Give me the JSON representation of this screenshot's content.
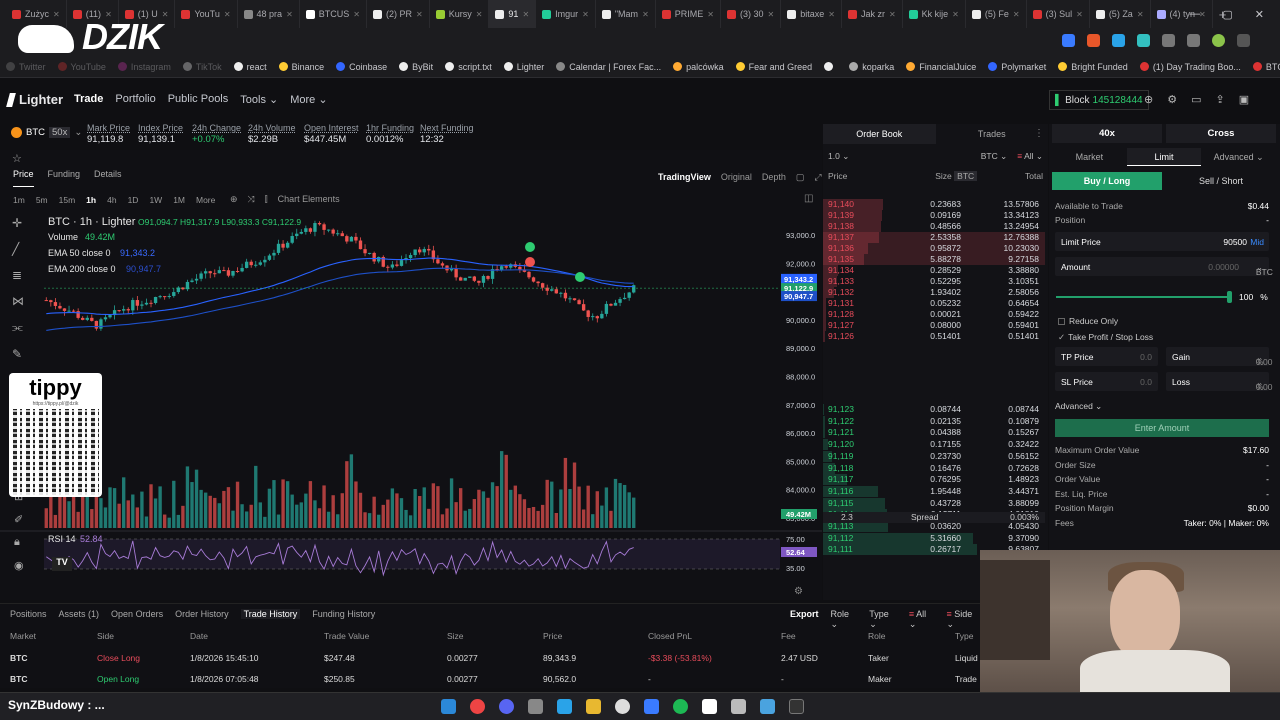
{
  "browser": {
    "tabs": [
      {
        "label": "Zużyc",
        "color": "#d33"
      },
      {
        "label": "(11)",
        "color": "#d33"
      },
      {
        "label": "(1) U",
        "color": "#d33"
      },
      {
        "label": "YouTu",
        "color": "#d33"
      },
      {
        "label": "48 pra",
        "color": "#888"
      },
      {
        "label": "BTCUS",
        "color": "#fff"
      },
      {
        "label": "(2) PR",
        "color": "#eee"
      },
      {
        "label": "Kursy",
        "color": "#9c3"
      },
      {
        "label": "91",
        "color": "#eee",
        "active": true
      },
      {
        "label": "Imgur",
        "color": "#2c9"
      },
      {
        "label": "\"Mam",
        "color": "#eee"
      },
      {
        "label": "PRIME",
        "color": "#d33"
      },
      {
        "label": "(3) 30",
        "color": "#d33"
      },
      {
        "label": "bitaxe",
        "color": "#eee"
      },
      {
        "label": "Jak zr",
        "color": "#d33"
      },
      {
        "label": "Kk kije",
        "color": "#2c9"
      },
      {
        "label": "(5) Fe",
        "color": "#eee"
      },
      {
        "label": "(3) Sul",
        "color": "#d33"
      },
      {
        "label": "(5) Za",
        "color": "#eee"
      },
      {
        "label": "(4) tyn",
        "color": "#aaf"
      }
    ],
    "new_tab": "+",
    "logo_text": "DZIK",
    "bookmarks": [
      {
        "label": "Twitter",
        "color": "#888"
      },
      {
        "label": "YouTube",
        "color": "#d33"
      },
      {
        "label": "Instagram",
        "color": "#c3a"
      },
      {
        "label": "TikTok",
        "color": "#eee"
      },
      {
        "label": "react",
        "color": "#eee"
      },
      {
        "label": "Binance",
        "color": "#fc3"
      },
      {
        "label": "Coinbase",
        "color": "#36f"
      },
      {
        "label": "ByBit",
        "color": "#eee"
      },
      {
        "label": "script.txt",
        "color": "#eee"
      },
      {
        "label": "Lighter",
        "color": "#eee"
      },
      {
        "label": "Calendar | Forex Fac...",
        "color": "#888"
      },
      {
        "label": "palcówka",
        "color": "#fa3"
      },
      {
        "label": "Fear and Greed",
        "color": "#fc3"
      },
      {
        "label": "",
        "color": "#eee"
      },
      {
        "label": "koparka",
        "color": "#aaa"
      },
      {
        "label": "FinancialJuice",
        "color": "#fa3"
      },
      {
        "label": "Polymarket",
        "color": "#36f"
      },
      {
        "label": "Bright Funded",
        "color": "#fc3"
      },
      {
        "label": "(1) Day Trading Boo...",
        "color": "#d33"
      },
      {
        "label": "BTC Elliot wave",
        "color": "#d33"
      }
    ]
  },
  "app": {
    "brand": "Lighter",
    "nav": [
      "Trade",
      "Portfolio",
      "Public Pools",
      "Tools",
      "More"
    ],
    "block_label": "Block",
    "block_number": "145128444"
  },
  "ticker": {
    "symbol": "BTC",
    "leverage": "50x",
    "stats": [
      {
        "label": "Mark Price",
        "value": "91,119.8",
        "tone": "normal"
      },
      {
        "label": "Index Price",
        "value": "91,139.1",
        "tone": "normal"
      },
      {
        "label": "24h Change",
        "value": "+0.07%",
        "tone": "green"
      },
      {
        "label": "24h Volume",
        "value": "$2.29B",
        "tone": "normal"
      },
      {
        "label": "Open Interest",
        "value": "$447.45M",
        "tone": "normal"
      },
      {
        "label": "1hr Funding",
        "value": "0.0012%",
        "tone": "normal"
      },
      {
        "label": "Next Funding",
        "value": "12:32",
        "tone": "normal"
      }
    ]
  },
  "chart": {
    "tabs": [
      "Price",
      "Funding",
      "Details"
    ],
    "views": [
      "TradingView",
      "Original",
      "Depth"
    ],
    "timeframes": [
      "1m",
      "5m",
      "15m",
      "1h",
      "4h",
      "1D",
      "1W",
      "1M",
      "More"
    ],
    "elements_label": "Chart Elements",
    "legend": {
      "title": "BTC · 1h · Lighter",
      "ohlc": "O91,094.7 H91,317.9 L90,933.3 C91,122.9",
      "volume_label": "Volume",
      "volume_value": "49.42M",
      "ema50_label": "EMA 50 close 0",
      "ema50_value": "91,343.2",
      "ema200_label": "EMA 200 close 0",
      "ema200_value": "90,947.7"
    },
    "price_axis": [
      "93,000.0",
      "92,000.0",
      "91,000.0",
      "90,000.0",
      "89,000.0",
      "88,000.0",
      "87,000.0",
      "86,000.0",
      "85,000.0",
      "84,000.0",
      "83,000.0"
    ],
    "price_tags": [
      "91,343.2",
      "91,122.9",
      "90,947.7"
    ],
    "volume_tag": "49.42M",
    "rsi": {
      "label": "RSI 14",
      "value": "52.84",
      "levels": [
        "75.00",
        "35.00"
      ],
      "tag": "52.64"
    },
    "tippy": {
      "title": "tippy",
      "url": "https://tippy.pl/@dzik"
    },
    "colors": {
      "up": "#26a69a",
      "down": "#ef5350",
      "ema50": "#2962ff",
      "ema200": "#1e50c8"
    }
  },
  "orderbook": {
    "tabs": [
      "Order Book",
      "Trades"
    ],
    "tick_size": "1.0",
    "unit": "BTC",
    "filter": "All",
    "headers": {
      "price": "Price",
      "size": "Size",
      "size_unit": "BTC",
      "total": "Total"
    },
    "asks": [
      [
        "91,140",
        "0.23683",
        "13.57806"
      ],
      [
        "91,139",
        "0.09169",
        "13.34123"
      ],
      [
        "91,138",
        "0.48566",
        "13.24954"
      ],
      [
        "91,137",
        "2.53358",
        "12.76388"
      ],
      [
        "91,136",
        "0.95872",
        "10.23030"
      ],
      [
        "91,135",
        "5.88278",
        "9.27158"
      ],
      [
        "91,134",
        "0.28529",
        "3.38880"
      ],
      [
        "91,133",
        "0.52295",
        "3.10351"
      ],
      [
        "91,132",
        "1.93402",
        "2.58056"
      ],
      [
        "91,131",
        "0.05232",
        "0.64654"
      ],
      [
        "91,128",
        "0.00021",
        "0.59422"
      ],
      [
        "91,127",
        "0.08000",
        "0.59401"
      ],
      [
        "91,126",
        "0.51401",
        "0.51401"
      ]
    ],
    "spread": {
      "value": "2.3",
      "label": "Spread",
      "pct": "0.003%"
    },
    "bids": [
      [
        "91,123",
        "0.08744",
        "0.08744"
      ],
      [
        "91,122",
        "0.02135",
        "0.10879"
      ],
      [
        "91,121",
        "0.04388",
        "0.15267"
      ],
      [
        "91,120",
        "0.17155",
        "0.32422"
      ],
      [
        "91,119",
        "0.23730",
        "0.56152"
      ],
      [
        "91,118",
        "0.16476",
        "0.72628"
      ],
      [
        "91,117",
        "0.76295",
        "1.48923"
      ],
      [
        "91,116",
        "1.95448",
        "3.44371"
      ],
      [
        "91,115",
        "0.43728",
        "3.88099"
      ],
      [
        "91,114",
        "0.13711",
        "4.01810"
      ],
      [
        "91,113",
        "0.03620",
        "4.05430"
      ],
      [
        "91,112",
        "5.31660",
        "9.37090"
      ],
      [
        "91,111",
        "0.26717",
        "9.63807"
      ]
    ]
  },
  "orderform": {
    "leverage": "40x",
    "margin_mode": "Cross",
    "type_tabs": [
      "Market",
      "Limit",
      "Advanced"
    ],
    "buy_label": "Buy / Long",
    "sell_label": "Sell / Short",
    "available_label": "Available to Trade",
    "available_value": "$0.44",
    "position_label": "Position",
    "position_value": "-",
    "limit_price_label": "Limit Price",
    "limit_price_value": "90500",
    "mid_label": "Mid",
    "amount_label": "Amount",
    "amount_value": "0.00000",
    "amount_unit": "BTC",
    "slider_pct": "100",
    "slider_unit": "%",
    "reduce_only": "Reduce Only",
    "tpsl_label": "Take Profit / Stop Loss",
    "tp_label": "TP Price",
    "tp_value": "0.0",
    "gain_label": "Gain",
    "gain_value": "0.00",
    "sl_label": "SL Price",
    "sl_value": "0.0",
    "loss_label": "Loss",
    "loss_value": "0.00",
    "pct": "%",
    "advanced_label": "Advanced",
    "enter_label": "Enter Amount",
    "summary": [
      {
        "label": "Maximum Order Value",
        "value": "$17.60"
      },
      {
        "label": "Order Size",
        "value": "-"
      },
      {
        "label": "Order Value",
        "value": "-"
      },
      {
        "label": "Est. Liq. Price",
        "value": "-"
      },
      {
        "label": "Position Margin",
        "value": "$0.00"
      },
      {
        "label": "Fees",
        "value": "Taker: 0% | Maker: 0%"
      }
    ]
  },
  "bottom": {
    "tabs": [
      "Positions",
      "Assets (1)",
      "Open Orders",
      "Order History",
      "Trade History",
      "Funding History"
    ],
    "active_tab": "Trade History",
    "controls": [
      "Export",
      "Role",
      "Type",
      "All",
      "Side"
    ],
    "columns": [
      "Market",
      "Side",
      "Date",
      "Trade Value",
      "Size",
      "Price",
      "Closed PnL",
      "Fee",
      "Role",
      "Type"
    ],
    "rows": [
      {
        "market": "BTC",
        "side": "Close Long",
        "date": "1/8/2026 15:45:10",
        "value": "$247.48",
        "size": "0.00277",
        "price": "89,343.9",
        "pnl": "-$3.38 (-53.81%)",
        "fee": "2.47 USD",
        "role": "Taker",
        "type": "Liquid"
      },
      {
        "market": "BTC",
        "side": "Open Long",
        "date": "1/8/2026 07:05:48",
        "value": "$250.85",
        "size": "0.00277",
        "price": "90,562.0",
        "pnl": "-",
        "fee": "-",
        "role": "Maker",
        "type": "Trade"
      }
    ]
  },
  "taskbar": {
    "label": "SynZBudowy : ..."
  }
}
